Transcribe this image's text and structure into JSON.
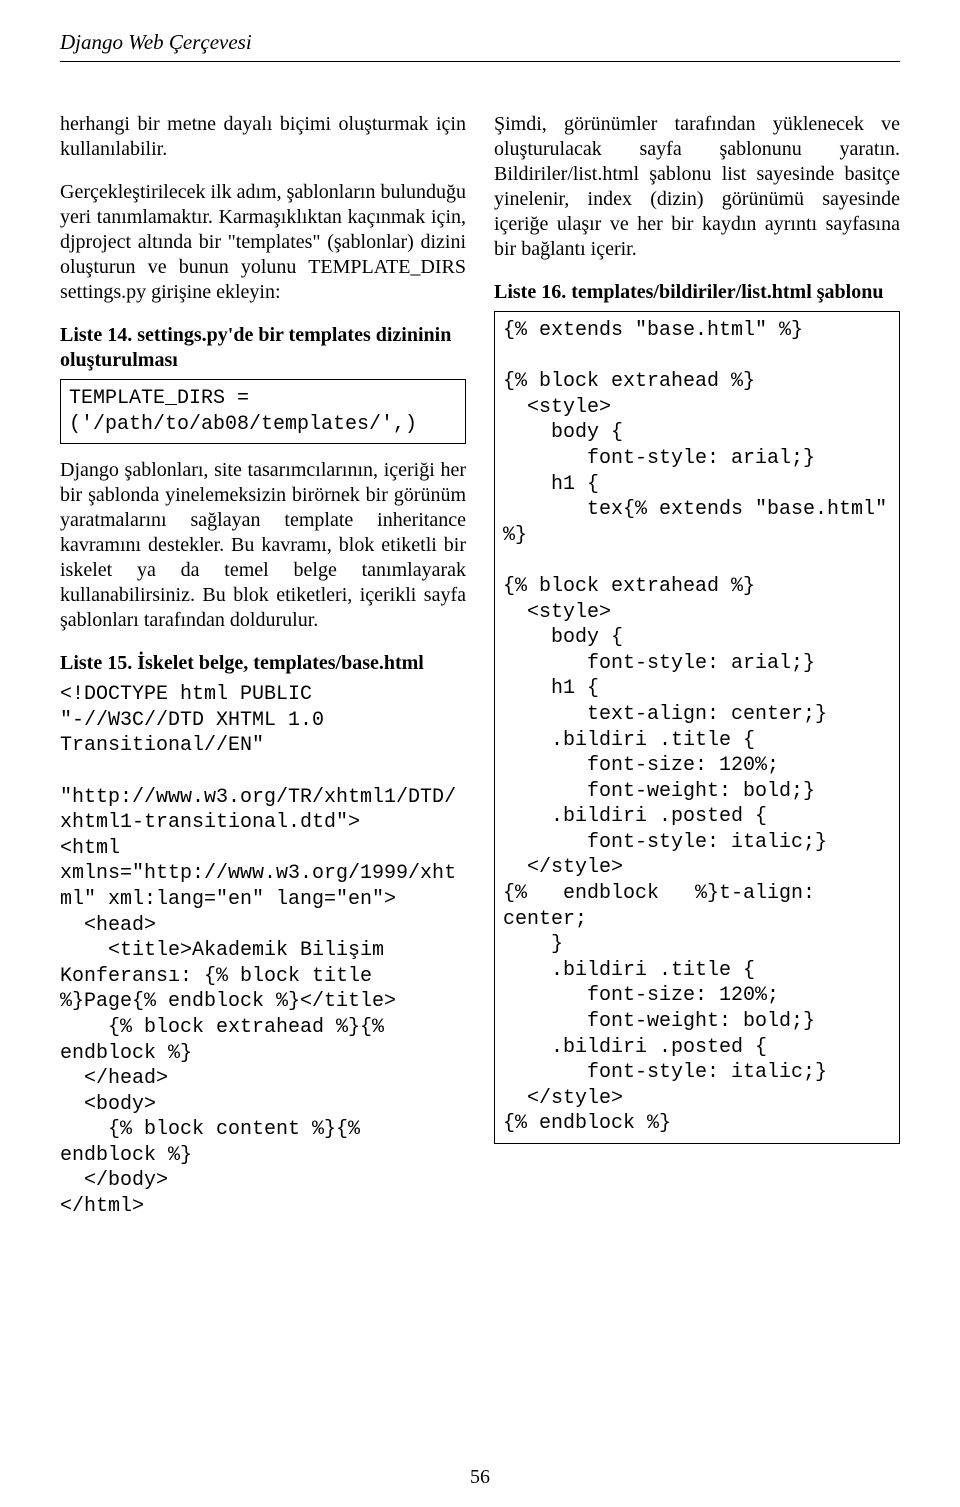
{
  "header": {
    "title": "Django Web Çerçevesi"
  },
  "left": {
    "p1": "herhangi bir metne dayalı biçimi oluşturmak için kullanılabilir.",
    "p2": "Gerçekleştirilecek ilk adım, şablonların bulunduğu yeri tanımlamaktır. Karmaşıklıktan kaçınmak için, djproject altında bir \"templates\" (şablonlar) dizini oluşturun ve bunun yolunu TEMPLATE_DIRS settings.py girişine ekleyin:",
    "list14_title": "Liste 14. settings.py'de bir templates dizininin oluşturulması",
    "code14": "TEMPLATE_DIRS = ('/path/to/ab08/templates/',)",
    "p3": "Django şablonları, site tasarımcılarının, içeriği her bir şablonda yinelemeksizin birörnek bir görünüm yaratmalarını sağlayan template inheritance kavramını destekler. Bu kavramı, blok etiketli bir iskelet ya da temel belge tanımlayarak kullanabilirsiniz. Bu blok etiketleri, içerikli sayfa şablonları tarafından doldurulur.",
    "list15_title": "Liste 15. İskelet belge, templates/base.html",
    "code15": "<!DOCTYPE html PUBLIC \"-//W3C//DTD XHTML 1.0 Transitional//EN\"\n        \"http://www.w3.org/TR/xhtml1/DTD/xhtml1-transitional.dtd\">\n<html xmlns=\"http://www.w3.org/1999/xhtml\" xml:lang=\"en\" lang=\"en\">\n  <head>\n    <title>Akademik Bilişim Konferansı: {% block title %}Page{% endblock %}</title>\n    {% block extrahead %}{% endblock %}\n  </head>\n  <body>\n    {% block content %}{% endblock %}\n  </body>\n</html>"
  },
  "right": {
    "p1": "Şimdi, görünümler tarafından yüklenecek ve oluşturulacak sayfa şablonunu yaratın. Bildiriler/list.html şablonu list sayesinde basitçe yinelenir, index (dizin) görünümü sayesinde içeriğe ulaşır ve her bir kaydın ayrıntı sayfasına bir bağlantı içerir.",
    "list16_title": "Liste 16. templates/bildiriler/list.html şablonu",
    "code16": "{% extends \"base.html\" %}\n\n{% block extrahead %}\n  <style>\n    body {\n       font-style: arial;}\n    h1 {\n       tex{% extends \"base.html\" %}\n\n{% block extrahead %}\n  <style>\n    body {\n       font-style: arial;}\n    h1 {\n       text-align: center;}\n    .bildiri .title {\n       font-size: 120%;\n       font-weight: bold;}\n    .bildiri .posted {\n       font-style: italic;}\n  </style>\n{%   endblock   %}t-align: center;\n    }\n    .bildiri .title {\n       font-size: 120%;\n       font-weight: bold;}\n    .bildiri .posted {\n       font-style: italic;}\n  </style>\n{% endblock %}"
  },
  "page_number": "56"
}
